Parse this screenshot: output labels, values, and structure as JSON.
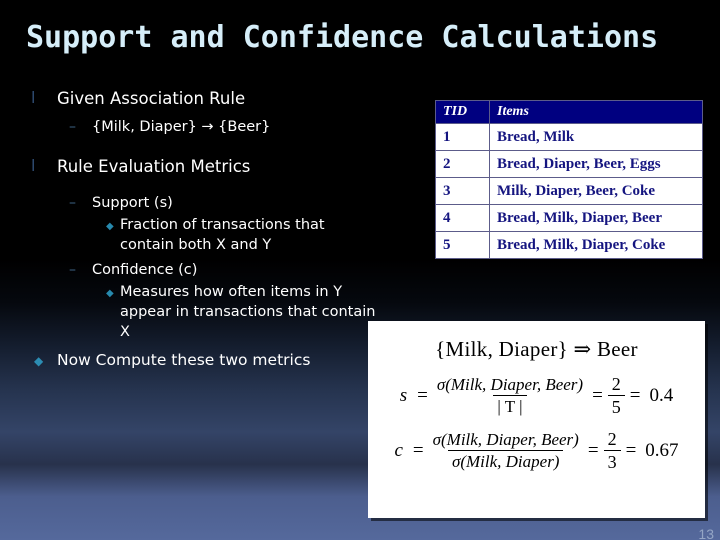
{
  "slide": {
    "title": "Support and Confidence Calculations",
    "page_number": "13",
    "accent_title_color": "#d6eef9",
    "bullet_diamond_color": "#2789ad",
    "table_header_bg": "#000080",
    "table_text_color": "#151580"
  },
  "bullets": {
    "b1": {
      "marker": "l",
      "text": "Given Association Rule"
    },
    "b1_sub": {
      "marker": "–",
      "text": "{Milk, Diaper} → {Beer}"
    },
    "b2": {
      "marker": "l",
      "text": "Rule Evaluation Metrics"
    },
    "b2_sub1": {
      "marker": "–",
      "text": "Support (s)"
    },
    "b2_sub1_a": {
      "marker": "◆",
      "text": "Fraction of transactions that contain both X and Y"
    },
    "b2_sub2": {
      "marker": "–",
      "text": "Confidence (c)"
    },
    "b2_sub2_a": {
      "marker": "◆",
      "text": "Measures how often items in Y appear in transactions that contain X"
    },
    "b3": {
      "marker": "◆",
      "text": "Now Compute these two metrics"
    }
  },
  "transactions_table": {
    "headers": [
      "TID",
      "Items"
    ],
    "rows": [
      [
        "1",
        "Bread, Milk"
      ],
      [
        "2",
        "Bread, Diaper, Beer, Eggs"
      ],
      [
        "3",
        "Milk, Diaper, Beer, Coke"
      ],
      [
        "4",
        "Bread, Milk, Diaper, Beer"
      ],
      [
        "5",
        "Bread, Milk, Diaper, Coke"
      ]
    ]
  },
  "formula": {
    "rule": "{Milk, Diaper} ⇒ Beer",
    "support": {
      "lhs": "s",
      "eq1": "=",
      "numerator": "σ(Milk, Diaper, Beer)",
      "denominator": "| T |",
      "eq2": "=",
      "frac_num": "2",
      "frac_den": "5",
      "eq3": "=",
      "result": "0.4"
    },
    "confidence": {
      "lhs": "c",
      "eq1": "=",
      "numerator": "σ(Milk, Diaper, Beer)",
      "denominator": "σ(Milk, Diaper)",
      "eq2": "=",
      "frac_num": "2",
      "frac_den": "3",
      "eq3": "=",
      "result": "0.67"
    }
  }
}
